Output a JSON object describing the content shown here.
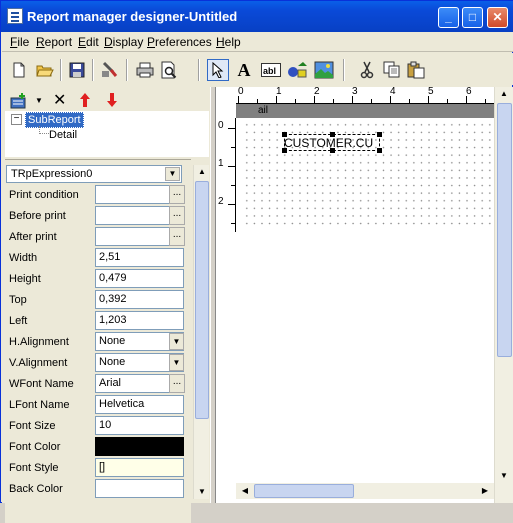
{
  "window": {
    "title": "Report manager designer-Untitled",
    "controls": {
      "minimize": "_",
      "maximize": "□",
      "close": "✕"
    }
  },
  "menu": [
    "File",
    "Report",
    "Edit",
    "Display",
    "Preferences",
    "Help"
  ],
  "toolbar": {
    "icons": [
      "new-file-icon",
      "open-folder-icon",
      "save-icon",
      "page-setup-icon",
      "print-icon",
      "print-preview-icon",
      "select-arrow-icon",
      "text-label-icon",
      "expression-field-icon",
      "shape-icon",
      "image-icon",
      "cut-icon",
      "copy-icon",
      "paste-icon"
    ]
  },
  "tree": {
    "root": "SubReport",
    "child": "Detail",
    "expander": "⊟"
  },
  "component_select": "TRpExpression0",
  "properties": [
    {
      "label": "Print condition",
      "value": "",
      "button": "..."
    },
    {
      "label": "Before print",
      "value": "",
      "button": "..."
    },
    {
      "label": "After print",
      "value": "",
      "button": "..."
    },
    {
      "label": "Width",
      "value": "2,51"
    },
    {
      "label": "Height",
      "value": "0,479"
    },
    {
      "label": "Top",
      "value": "0,392"
    },
    {
      "label": "Left",
      "value": "1,203"
    },
    {
      "label": "H.Alignment",
      "value": "None",
      "dropdown": "▼"
    },
    {
      "label": "V.Alignment",
      "value": "None",
      "dropdown": "▼"
    },
    {
      "label": "WFont Name",
      "value": "Arial",
      "button": "..."
    },
    {
      "label": "LFont Name",
      "value": "Helvetica"
    },
    {
      "label": "Font Size",
      "value": "10"
    },
    {
      "label": "Font Color",
      "value": "",
      "color": "#000000"
    },
    {
      "label": "Font Style",
      "value": "[]"
    },
    {
      "label": "Back Color",
      "value": "",
      "color": "#ffffff"
    }
  ],
  "design": {
    "section_header": "ail",
    "element_text": "CUSTOMER.CU",
    "ruler_h": [
      "0",
      "1",
      "2",
      "3",
      "4",
      "5",
      "6"
    ],
    "ruler_v": [
      "0",
      "1",
      "2"
    ]
  },
  "colors": {
    "titlebar": "#0a4ad8",
    "selection": "#316ac5",
    "accent_red": "#e02020"
  }
}
